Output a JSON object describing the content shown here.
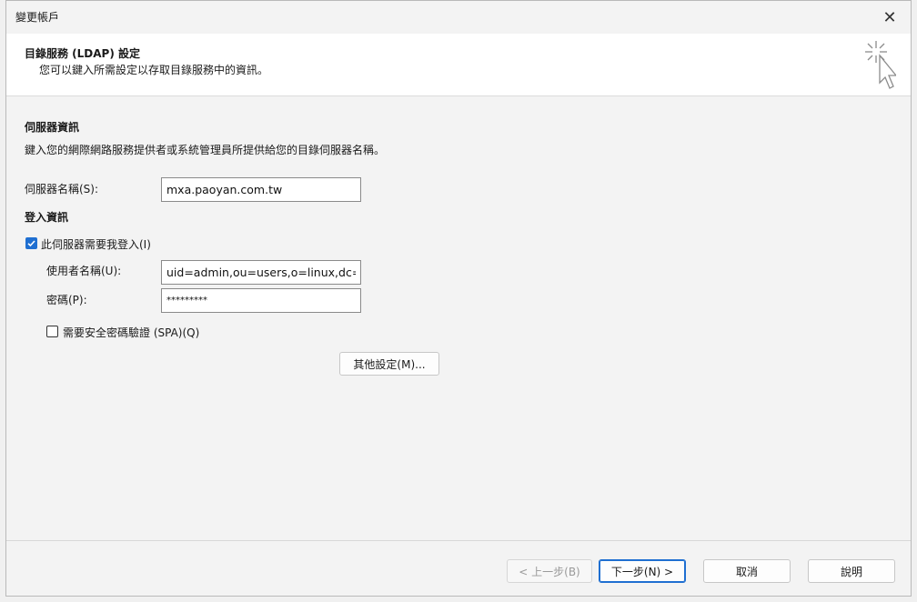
{
  "window": {
    "title": "變更帳戶",
    "close_glyph": "✕"
  },
  "header": {
    "title": "目錄服務 (LDAP) 設定",
    "subtitle": "您可以鍵入所需設定以存取目錄服務中的資訊。",
    "icon": "wizard-cursor-icon"
  },
  "server_info": {
    "heading": "伺服器資訊",
    "description": "鍵入您的網際網路服務提供者或系統管理員所提供給您的目錄伺服器名稱。",
    "server_name_label": "伺服器名稱(S):",
    "server_name_value": "mxa.paoyan.com.tw"
  },
  "login_info": {
    "heading": "登入資訊",
    "require_login_label": "此伺服器需要我登入(I)",
    "require_login_checked": true,
    "username_label": "使用者名稱(U):",
    "username_value": "uid=admin,ou=users,o=linux,dc=",
    "password_label": "密碼(P):",
    "password_value": "*********",
    "spa_label": "需要安全密碼驗證 (SPA)(Q)",
    "spa_checked": false
  },
  "more_settings_label": "其他設定(M)...",
  "footer": {
    "back_label": "< 上一步(B)",
    "next_label": "下一步(N) >",
    "cancel_label": "取消",
    "help_label": "說明"
  },
  "colors": {
    "accent": "#1f6fd1",
    "background": "#f3f3f3"
  }
}
